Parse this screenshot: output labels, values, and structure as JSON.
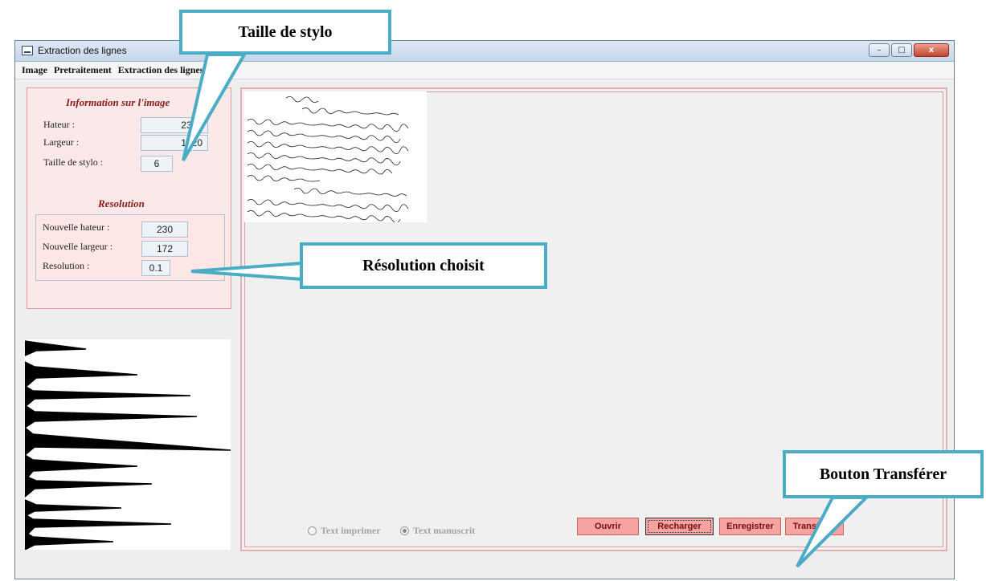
{
  "window": {
    "title": "Extraction des lignes",
    "controls": [
      "–",
      "□",
      "x"
    ]
  },
  "menu": [
    "Image",
    "Pretraitement",
    "Extraction des lignes"
  ],
  "info": {
    "title": "Information sur l'image",
    "height_label": "Hateur :",
    "height_value": "2305",
    "width_label": "Largeur :",
    "width_value": "1720",
    "pen_label": "Taille de stylo :",
    "pen_value": "6"
  },
  "resolution": {
    "title": "Resolution",
    "new_height_label": "Nouvelle hateur :",
    "new_height_value": "230",
    "new_width_label": "Nouvelle largeur :",
    "new_width_value": "172",
    "resolution_label": "Resolution :",
    "resolution_value": "0.1"
  },
  "text_type": {
    "options": [
      {
        "label": "Text imprimer",
        "selected": false
      },
      {
        "label": "Text manuscrit",
        "selected": true
      }
    ]
  },
  "buttons": {
    "open": "Ouvrir",
    "reload": "Recharger",
    "save": "Enregistrer",
    "transfer": "Transferer"
  },
  "annotations": {
    "pen_size": "Taille de stylo",
    "resolution": "Résolution choisit",
    "transfer": "Bouton Transférer"
  },
  "colors": {
    "accent": "#4bacc6",
    "section_title": "#8b1a1a",
    "button": "#f5a3a3"
  }
}
